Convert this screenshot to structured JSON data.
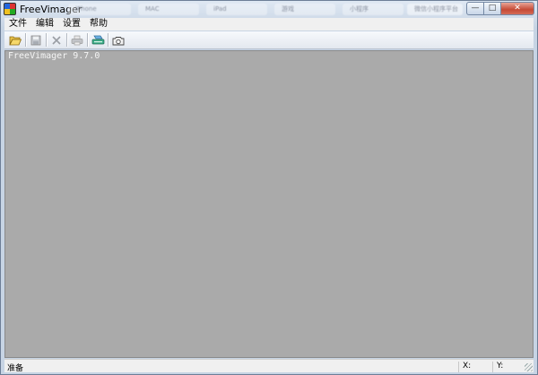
{
  "window": {
    "title": "FreeVimager"
  },
  "taskbar_tabs": [
    "iPhone",
    "MAC",
    "iPad",
    "游戏",
    "小程序",
    "微信小程序平台"
  ],
  "window_controls": {
    "minimize": "—",
    "maximize": "□",
    "close": "✕"
  },
  "menu": [
    {
      "id": "file",
      "label": "文件"
    },
    {
      "id": "edit",
      "label": "编辑"
    },
    {
      "id": "settings",
      "label": "设置"
    },
    {
      "id": "help",
      "label": "帮助"
    }
  ],
  "toolbar": [
    {
      "id": "open",
      "icon": "folder-open-icon",
      "enabled": true
    },
    {
      "id": "save",
      "icon": "save-icon",
      "enabled": false
    },
    {
      "id": "close-file",
      "icon": "close-x-icon",
      "enabled": false
    },
    {
      "id": "print",
      "icon": "printer-icon",
      "enabled": false
    },
    {
      "id": "scan",
      "icon": "scanner-icon",
      "enabled": true
    },
    {
      "id": "capture",
      "icon": "camera-icon",
      "enabled": true
    }
  ],
  "client": {
    "version_text": "FreeVimager 9.7.0",
    "background": "#aaaaaa"
  },
  "status": {
    "text": "准备",
    "x_label": "X:",
    "y_label": "Y:"
  }
}
